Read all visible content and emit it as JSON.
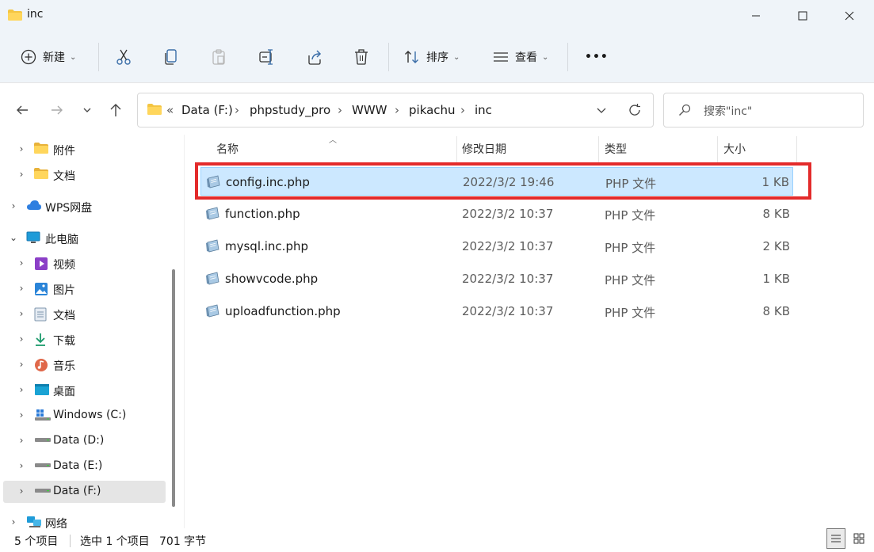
{
  "window": {
    "title": "inc"
  },
  "toolbar": {
    "new_label": "新建",
    "sort_label": "排序",
    "view_label": "查看",
    "more_label": "•••"
  },
  "address": {
    "overflow": "«",
    "crumbs": [
      "Data (F:)",
      "phpstudy_pro",
      "WWW",
      "pikachu",
      "inc"
    ],
    "separator": "›"
  },
  "search": {
    "placeholder": "搜索\"inc\""
  },
  "sidebar": {
    "items": [
      {
        "label": "附件",
        "icon": "folder-icon"
      },
      {
        "label": "文档",
        "icon": "folder-icon"
      },
      {
        "label": "WPS网盘",
        "icon": "cloud-icon"
      },
      {
        "label": "此电脑",
        "icon": "computer-icon"
      },
      {
        "label": "视频",
        "icon": "video-icon"
      },
      {
        "label": "图片",
        "icon": "picture-icon"
      },
      {
        "label": "文档",
        "icon": "document-icon"
      },
      {
        "label": "下载",
        "icon": "download-icon"
      },
      {
        "label": "音乐",
        "icon": "music-icon"
      },
      {
        "label": "桌面",
        "icon": "desktop-icon"
      },
      {
        "label": "Windows (C:)",
        "icon": "windows-drive-icon"
      },
      {
        "label": "Data (D:)",
        "icon": "drive-icon"
      },
      {
        "label": "Data (E:)",
        "icon": "drive-icon"
      },
      {
        "label": "Data (F:)",
        "icon": "drive-icon"
      },
      {
        "label": "网络",
        "icon": "network-icon"
      }
    ]
  },
  "columns": {
    "name": "名称",
    "modified": "修改日期",
    "type": "类型",
    "size": "大小"
  },
  "files": [
    {
      "name": "config.inc.php",
      "modified": "2022/3/2 19:46",
      "type": "PHP 文件",
      "size": "1 KB"
    },
    {
      "name": "function.php",
      "modified": "2022/3/2 10:37",
      "type": "PHP 文件",
      "size": "8 KB"
    },
    {
      "name": "mysql.inc.php",
      "modified": "2022/3/2 10:37",
      "type": "PHP 文件",
      "size": "2 KB"
    },
    {
      "name": "showvcode.php",
      "modified": "2022/3/2 10:37",
      "type": "PHP 文件",
      "size": "1 KB"
    },
    {
      "name": "uploadfunction.php",
      "modified": "2022/3/2 10:37",
      "type": "PHP 文件",
      "size": "8 KB"
    }
  ],
  "status": {
    "count": "5 个项目",
    "selection": "选中 1 个项目",
    "size": "701 字节"
  },
  "colors": {
    "selection_bg": "#cce8ff",
    "highlight": "#e32b2b",
    "folder": "#f4c542"
  }
}
